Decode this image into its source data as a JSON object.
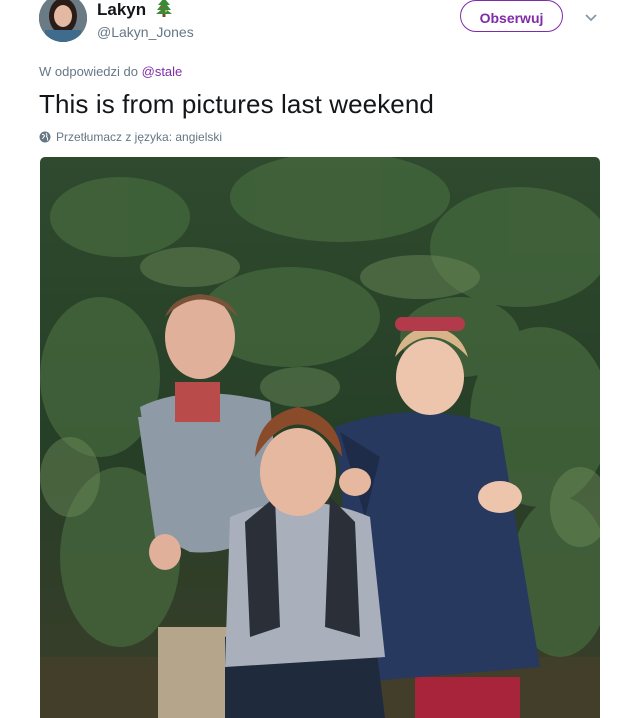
{
  "user": {
    "display_name": "Lakyn",
    "emoji": "christmas-tree",
    "handle": "@Lakyn_Jones"
  },
  "follow_button": {
    "label": "Obserwuj"
  },
  "reply": {
    "prefix": "W odpowiedzi do",
    "mention": "@stale"
  },
  "tweet": {
    "text": "This is from pictures last weekend"
  },
  "translate": {
    "label": "Przetłumacz z języka: angielski"
  },
  "colors": {
    "accent": "#7e2ca8",
    "secondary_text": "#657786"
  },
  "icons": {
    "caret": "chevron-down-icon",
    "globe": "globe-icon"
  }
}
